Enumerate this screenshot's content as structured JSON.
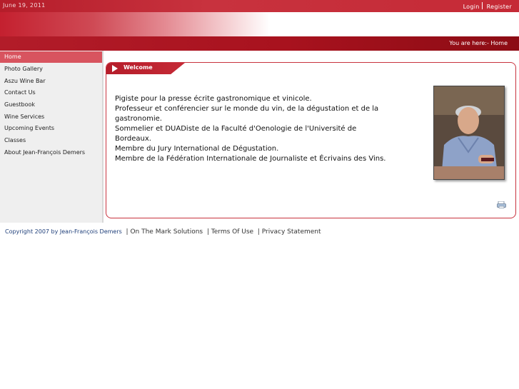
{
  "header": {
    "date": "June 19, 2011",
    "login_label": "Login",
    "register_label": "Register",
    "breadcrumb": "You are here:- Home"
  },
  "sidebar": {
    "items": [
      {
        "label": "Home"
      },
      {
        "label": "Photo Gallery"
      },
      {
        "label": "Aszu Wine Bar"
      },
      {
        "label": "Contact Us"
      },
      {
        "label": "Guestbook"
      },
      {
        "label": "Wine Services"
      },
      {
        "label": "Upcoming Events"
      },
      {
        "label": "Classes"
      },
      {
        "label": "About Jean-François Demers"
      }
    ]
  },
  "main": {
    "tab_title": "Welcome",
    "bio_lines": [
      "Pigiste pour la presse écrite gastronomique et vinicole.",
      "Professeur et conférencier sur le monde du vin, de la dégustation et de la",
      "gastronomie.",
      "Sommelier et DUADiste de la Faculté d'Oenologie de l'Université de Bordeaux.",
      "Membre du Jury International de Dégustation.",
      "Membre de la Fédération Internationale de Journaliste et Écrivains des Vins."
    ]
  },
  "footer": {
    "copyright": "Copyright 2007 by Jean-François Demers",
    "links": [
      "On The Mark Solutions",
      "Terms Of Use",
      "Privacy Statement"
    ],
    "separator": "|"
  },
  "colors": {
    "brand_red": "#c8323e",
    "active_nav": "#d8545f"
  }
}
